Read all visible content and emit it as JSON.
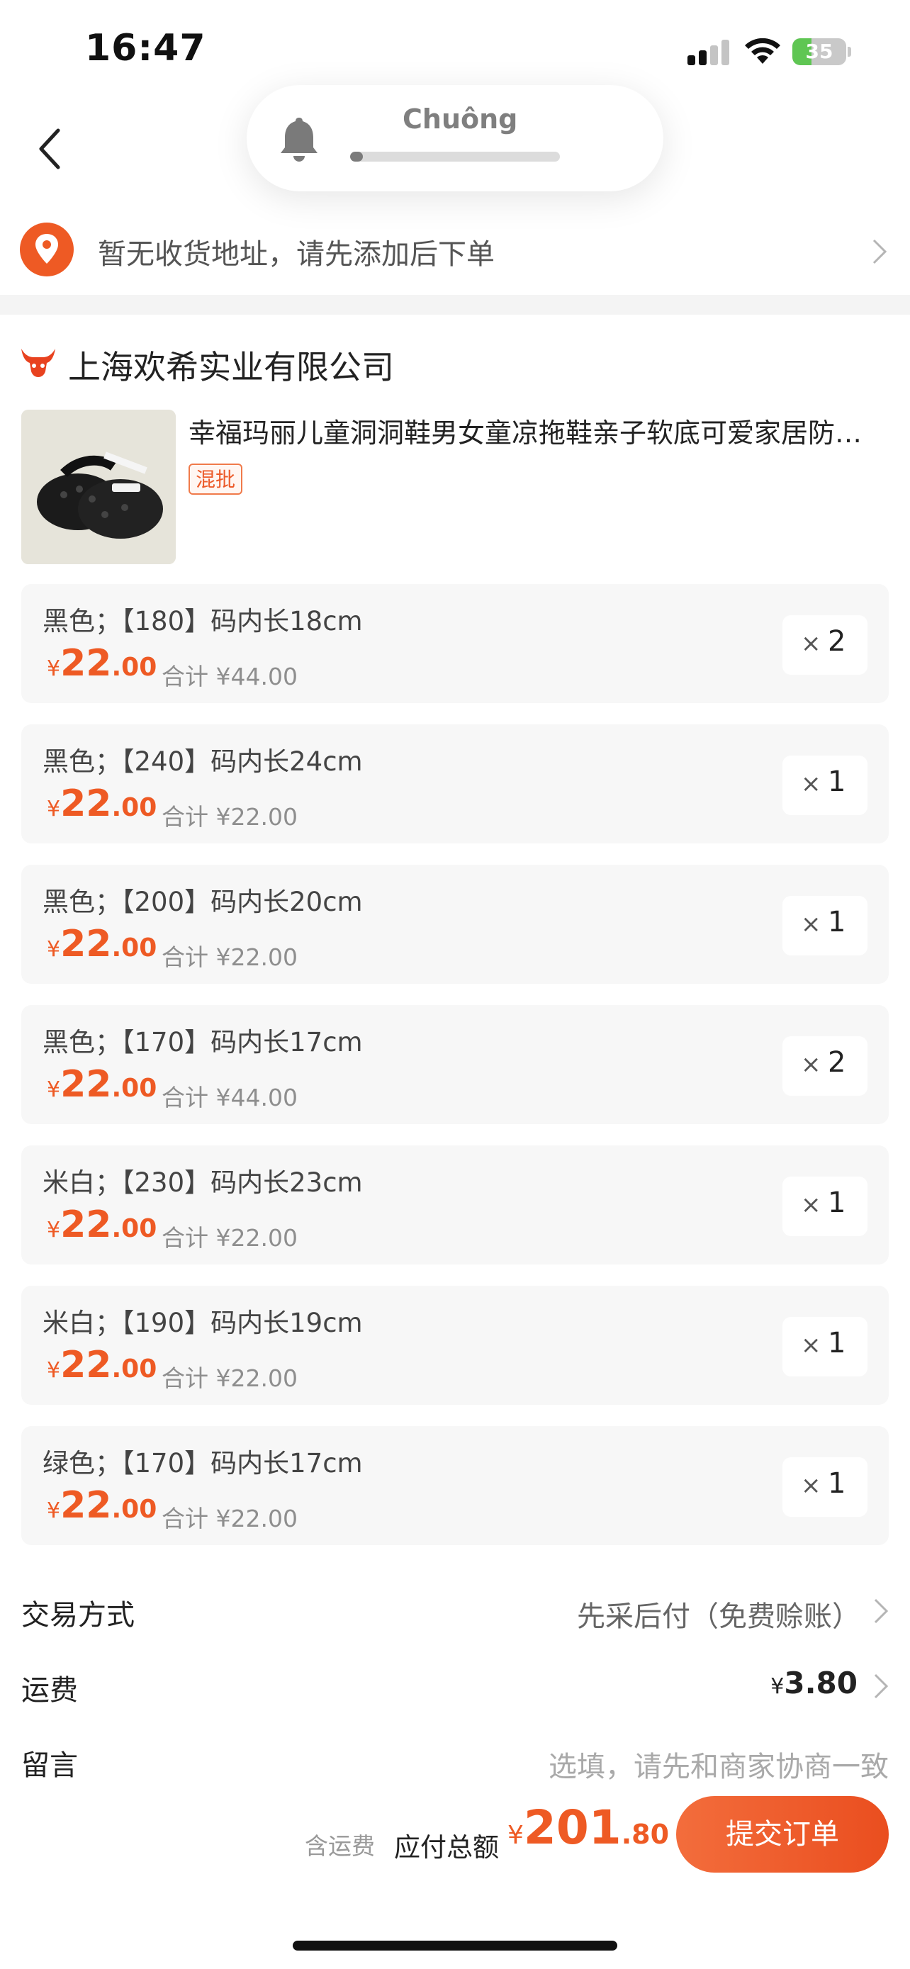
{
  "status_bar": {
    "time": "16:47",
    "battery_percent": "35",
    "battery_level": 0.35
  },
  "notification": {
    "label": "Chuông",
    "level": 0.06,
    "icon": "bell-icon"
  },
  "address": {
    "text": "暂无收货地址，请先添加后下单",
    "icon": "location-pin-icon",
    "accent": "#ee5a24"
  },
  "seller": {
    "name": "上海欢希实业有限公司",
    "icon": "bull-logo-icon"
  },
  "product": {
    "title": "幸福玛丽儿童洞洞鞋男女童凉拖鞋亲子软底可爱家居防滑拖鞋",
    "tag": "混批"
  },
  "variants": [
    {
      "spec": "黑色；【180】码内长18cm",
      "price_symbol": "¥",
      "price_int": "22",
      "price_dec": ".00",
      "subtotal": "合计 ¥44.00",
      "qty_x": "×",
      "qty": "2"
    },
    {
      "spec": "黑色；【240】码内长24cm",
      "price_symbol": "¥",
      "price_int": "22",
      "price_dec": ".00",
      "subtotal": "合计 ¥22.00",
      "qty_x": "×",
      "qty": "1"
    },
    {
      "spec": "黑色；【200】码内长20cm",
      "price_symbol": "¥",
      "price_int": "22",
      "price_dec": ".00",
      "subtotal": "合计 ¥22.00",
      "qty_x": "×",
      "qty": "1"
    },
    {
      "spec": "黑色；【170】码内长17cm",
      "price_symbol": "¥",
      "price_int": "22",
      "price_dec": ".00",
      "subtotal": "合计 ¥44.00",
      "qty_x": "×",
      "qty": "2"
    },
    {
      "spec": "米白；【230】码内长23cm",
      "price_symbol": "¥",
      "price_int": "22",
      "price_dec": ".00",
      "subtotal": "合计 ¥22.00",
      "qty_x": "×",
      "qty": "1"
    },
    {
      "spec": "米白；【190】码内长19cm",
      "price_symbol": "¥",
      "price_int": "22",
      "price_dec": ".00",
      "subtotal": "合计 ¥22.00",
      "qty_x": "×",
      "qty": "1"
    },
    {
      "spec": "绿色；【170】码内长17cm",
      "price_symbol": "¥",
      "price_int": "22",
      "price_dec": ".00",
      "subtotal": "合计 ¥22.00",
      "qty_x": "×",
      "qty": "1"
    }
  ],
  "payment": {
    "label": "交易方式",
    "value": "先采后付（免费赊账）"
  },
  "freight": {
    "label": "运费",
    "symbol": "¥",
    "value": "3.80"
  },
  "message": {
    "label": "留言",
    "placeholder": "选填，请先和商家协商一致"
  },
  "footer": {
    "shipping_note": "含运费",
    "total_label": "应付总额",
    "total_symbol": "¥",
    "total_int": "201",
    "total_dec": ".80",
    "submit_label": "提交订单"
  },
  "colors": {
    "accent": "#ee5a24",
    "battery": "#5fc653"
  }
}
